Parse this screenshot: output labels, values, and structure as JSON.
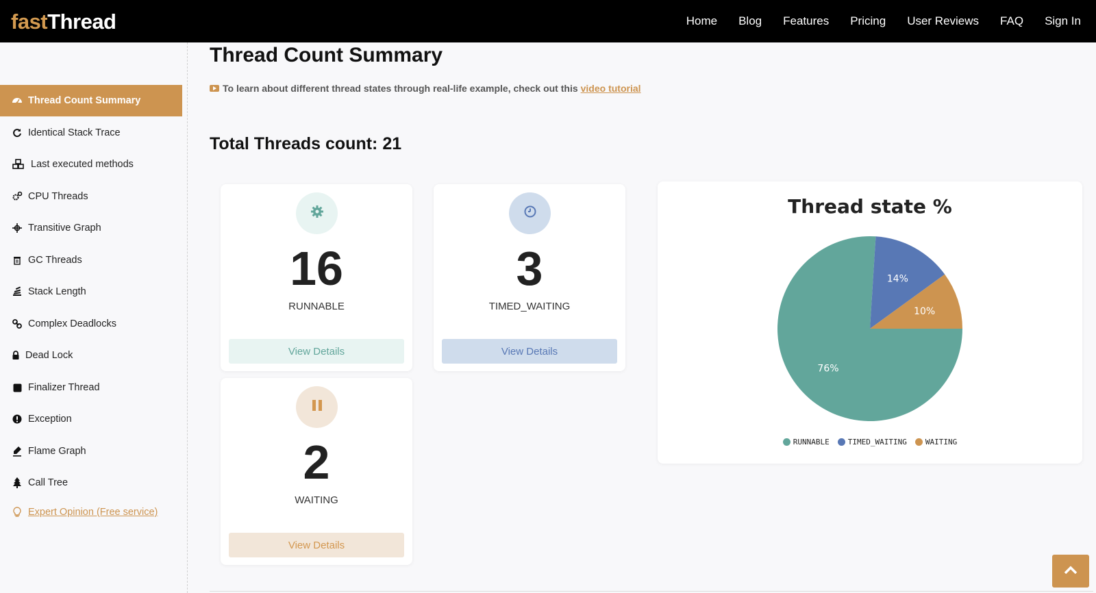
{
  "header": {
    "logo_part1": "fast",
    "logo_part2": "Thread",
    "nav": [
      "Home",
      "Blog",
      "Features",
      "Pricing",
      "User Reviews",
      "FAQ",
      "Sign In"
    ]
  },
  "sidebar": {
    "items": [
      {
        "label": "Thread Count Summary",
        "icon": "dashboard-icon"
      },
      {
        "label": "Identical Stack Trace",
        "icon": "refresh-icon"
      },
      {
        "label": "Last executed methods",
        "icon": "cubes-icon"
      },
      {
        "label": "CPU Threads",
        "icon": "cogs-icon"
      },
      {
        "label": "Transitive Graph",
        "icon": "crosshair-icon"
      },
      {
        "label": "GC Threads",
        "icon": "trash-icon"
      },
      {
        "label": "Stack Length",
        "icon": "stack-icon"
      },
      {
        "label": "Complex Deadlocks",
        "icon": "link-icon"
      },
      {
        "label": "Dead Lock",
        "icon": "lock-icon"
      },
      {
        "label": "Finalizer Thread",
        "icon": "stop-icon"
      },
      {
        "label": "Exception",
        "icon": "exclamation-icon"
      },
      {
        "label": "Flame Graph",
        "icon": "pen-icon"
      },
      {
        "label": "Call Tree",
        "icon": "tree-icon"
      },
      {
        "label": "Expert Opinion (Free service)",
        "icon": "lightbulb-icon"
      }
    ]
  },
  "main": {
    "title": "Thread Count Summary",
    "tutorial_text": "To learn about different thread states through real-life example, check out this",
    "tutorial_link": "video tutorial",
    "total": "Total Threads count: 21"
  },
  "cards": [
    {
      "count": "16",
      "state": "RUNNABLE",
      "button": "View Details",
      "icon": "gear-icon",
      "color": "#62a69b",
      "light": "#e8f4f2"
    },
    {
      "count": "3",
      "state": "TIMED_WAITING",
      "button": "View Details",
      "icon": "clock-icon",
      "color": "#5878b5",
      "light": "#cfdcec"
    },
    {
      "count": "2",
      "state": "WAITING",
      "button": "View Details",
      "icon": "pause-icon",
      "color": "#d3974f",
      "light": "#f2e6d9"
    }
  ],
  "chart_data": {
    "type": "pie",
    "title": "Thread state %",
    "categories": [
      "RUNNABLE",
      "TIMED_WAITING",
      "WAITING"
    ],
    "values": [
      76,
      14,
      10
    ],
    "labels": [
      "76%",
      "14%",
      "10%"
    ],
    "colors": [
      "#62a69b",
      "#5878b5",
      "#cd9450"
    ],
    "legend": "bottom"
  }
}
